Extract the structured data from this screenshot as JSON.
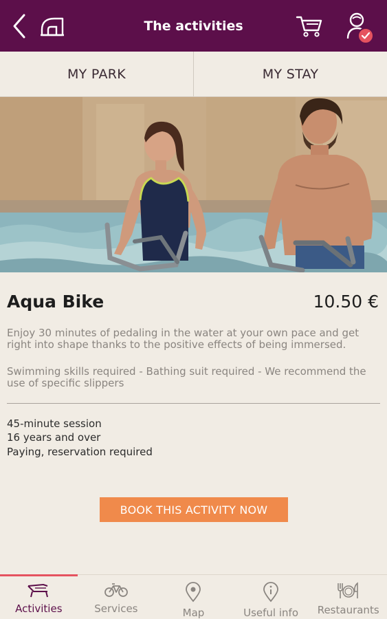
{
  "header": {
    "title": "The activities",
    "icons": [
      "back-icon",
      "home-icon",
      "cart-icon",
      "user-check-icon"
    ]
  },
  "tabs": [
    {
      "label": "MY PARK",
      "active": true
    },
    {
      "label": "MY STAY",
      "active": false
    }
  ],
  "activity": {
    "title": "Aqua Bike",
    "price": "10.50 €",
    "description": "Enjoy 30 minutes of pedaling in the water at your own pace and get right into shape thanks to the positive effects of being immersed.",
    "requirements": "Swimming skills required - Bathing suit required - We recommend the use of specific slippers",
    "details": [
      "45-minute session",
      "16 years and over",
      "Paying, reservation required"
    ],
    "book_label": "BOOK THIS ACTIVITY NOW"
  },
  "bottom_nav": [
    {
      "label": "Activities",
      "icon": "lounger-icon",
      "active": true
    },
    {
      "label": "Services",
      "icon": "bicycle-icon",
      "active": false
    },
    {
      "label": "Map",
      "icon": "map-pin-icon",
      "active": false
    },
    {
      "label": "Useful info",
      "icon": "info-icon",
      "active": false
    },
    {
      "label": "Restaurants",
      "icon": "cutlery-icon",
      "active": false
    }
  ],
  "colors": {
    "header_bg": "#5c0f4a",
    "accent": "#e5535f",
    "button": "#f08a4b",
    "background": "#f1ece4"
  }
}
